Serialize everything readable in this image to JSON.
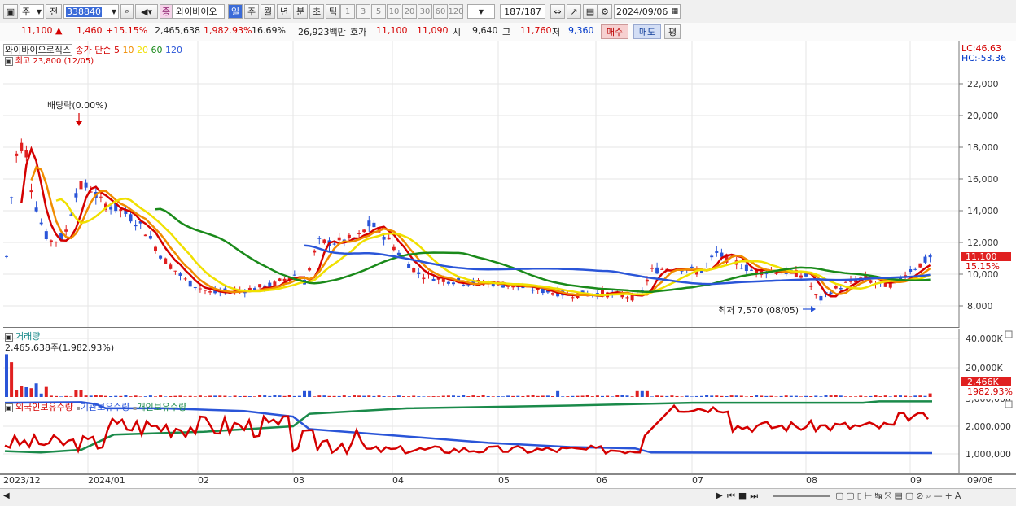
{
  "toolbar": {
    "period_select": "주",
    "prev_label": "전",
    "code_value": "338840",
    "stock_badge": "종",
    "stock_name": "와이바이오",
    "periods": [
      "일",
      "주",
      "월",
      "년",
      "분",
      "초",
      "틱"
    ],
    "active_period": "일",
    "interval_buttons": [
      "1",
      "3",
      "5",
      "10",
      "20",
      "30",
      "60",
      "120"
    ],
    "count_value": "187",
    "count_total": "/187",
    "date_value": "2024/09/06"
  },
  "quote": {
    "price": "11,100",
    "change_arrow": "▲",
    "change": "1,460",
    "change_pct": "+15.15%",
    "volume": "2,465,638",
    "volume_ratio": "1,982.93%",
    "turnover": "16.69%",
    "amount": "26,923백만",
    "hoga_label": "호가",
    "ask": "11,100",
    "bid": "11,090",
    "open_label": "시",
    "open": "9,640",
    "high_label": "고",
    "high": "11,760",
    "low_label": "저",
    "low": "9,360",
    "buy_label": "매수",
    "sell_label": "매도",
    "eval_label": "평"
  },
  "price_panel": {
    "stock_label": "와이바이오로직스",
    "ma_label": "종가 단순",
    "ma_periods": [
      "5",
      "10",
      "20",
      "60",
      "120"
    ],
    "ma_colors": [
      "#d40000",
      "#f08c00",
      "#f0e000",
      "#1a8a1a",
      "#2a55d8"
    ],
    "high_marker": "최고 23,800 (12/05)",
    "dividend_label": "배당락(0.00%)",
    "low_marker": "최저 7,570 (08/05)",
    "lc_label": "LC:46.63",
    "hc_label": "HC:-53.36",
    "current_price_tag": "11,100",
    "current_pct_tag": "15.15%",
    "y_ticks": [
      "22,000",
      "20,000",
      "18,000",
      "16,000",
      "14,000",
      "12,000",
      "10,000",
      "8,000"
    ]
  },
  "volume_panel": {
    "title": "거래량",
    "info": "2,465,638주(1,982.93%)",
    "y_ticks": [
      "40,000K",
      "20,000K"
    ],
    "current_tag": "2,466K",
    "current_pct": "1982.93%"
  },
  "holdings_panel": {
    "series_labels": [
      "외국인보유수량",
      "기관보유수량",
      "개인보유수량"
    ],
    "series_colors": [
      "#d40000",
      "#2a55d8",
      "#1a8a4a"
    ],
    "y_ticks": [
      "3,000,000",
      "2,000,000",
      "1,000,000"
    ]
  },
  "x_axis": [
    "2023/12",
    "2024/01",
    "02",
    "03",
    "04",
    "05",
    "06",
    "07",
    "08",
    "09",
    "09/06"
  ],
  "chart_data": {
    "type": "line",
    "x": [
      "2023/12",
      "2024/01",
      "02",
      "03",
      "04",
      "05",
      "06",
      "07",
      "08",
      "09"
    ],
    "series": [
      {
        "name": "종가",
        "values": [
          12000,
          14000,
          9000,
          12000,
          9600,
          9300,
          9900,
          10200,
          9300,
          11100
        ]
      }
    ],
    "ylim": [
      7000,
      24000
    ],
    "high": 23800,
    "low": 7570
  }
}
